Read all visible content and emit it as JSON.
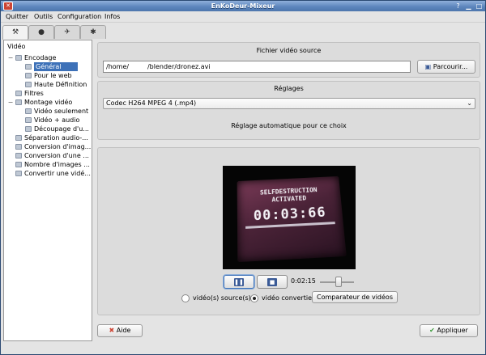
{
  "window": {
    "title": "EnKoDeur-Mixeur"
  },
  "menubar": {
    "items": [
      "Quitter",
      "Outils",
      "Configuration",
      "Infos"
    ]
  },
  "tabs": [
    {
      "icon": "tools-icon",
      "glyph": "⚒"
    },
    {
      "icon": "film-icon",
      "glyph": "●"
    },
    {
      "icon": "plane-icon",
      "glyph": "✈"
    },
    {
      "icon": "gear-icon",
      "glyph": "✱"
    }
  ],
  "tree": {
    "header": "Vidéo",
    "items": [
      {
        "label": "Encodage",
        "level": 1,
        "expander": "−"
      },
      {
        "label": "Général",
        "level": 2,
        "selected": true
      },
      {
        "label": "Pour le web",
        "level": 2
      },
      {
        "label": "Haute Définition",
        "level": 2
      },
      {
        "label": "Filtres",
        "level": 1
      },
      {
        "label": "Montage vidéo",
        "level": 1,
        "expander": "−"
      },
      {
        "label": "Vidéo seulement",
        "level": 2
      },
      {
        "label": "Vidéo + audio",
        "level": 2
      },
      {
        "label": "Découpage d'u...",
        "level": 2
      },
      {
        "label": "Séparation audio-...",
        "level": 1
      },
      {
        "label": "Conversion d'imag...",
        "level": 1
      },
      {
        "label": "Conversion d'une ...",
        "level": 1
      },
      {
        "label": "Nombre d'images ...",
        "level": 1
      },
      {
        "label": "Convertir une vidé...",
        "level": 1
      }
    ]
  },
  "source": {
    "title": "Fichier vidéo source",
    "path": "/home/         /blender/dronez.avi",
    "browse_label": "Parcourir..."
  },
  "settings": {
    "title": "Réglages",
    "codec": "Codec H264 MPEG 4 (.mp4)",
    "auto_text": "Réglage automatique pour ce choix"
  },
  "player": {
    "overlay_line1": "SELFDESTRUCTION",
    "overlay_line2": "ACTIVATED",
    "overlay_time": "00:03:66",
    "time": "0:02:15",
    "position": 0.55,
    "radio_source_label": "vidéo(s) source(s)",
    "radio_converted_label": "vidéo convertie",
    "selected_radio": "converted",
    "compare_label": "Comparateur de vidéos"
  },
  "footer": {
    "help_label": "Aide",
    "apply_label": "Appliquer"
  },
  "colors": {
    "selection": "#3d71b8",
    "titlebar": "#5d86bd"
  }
}
